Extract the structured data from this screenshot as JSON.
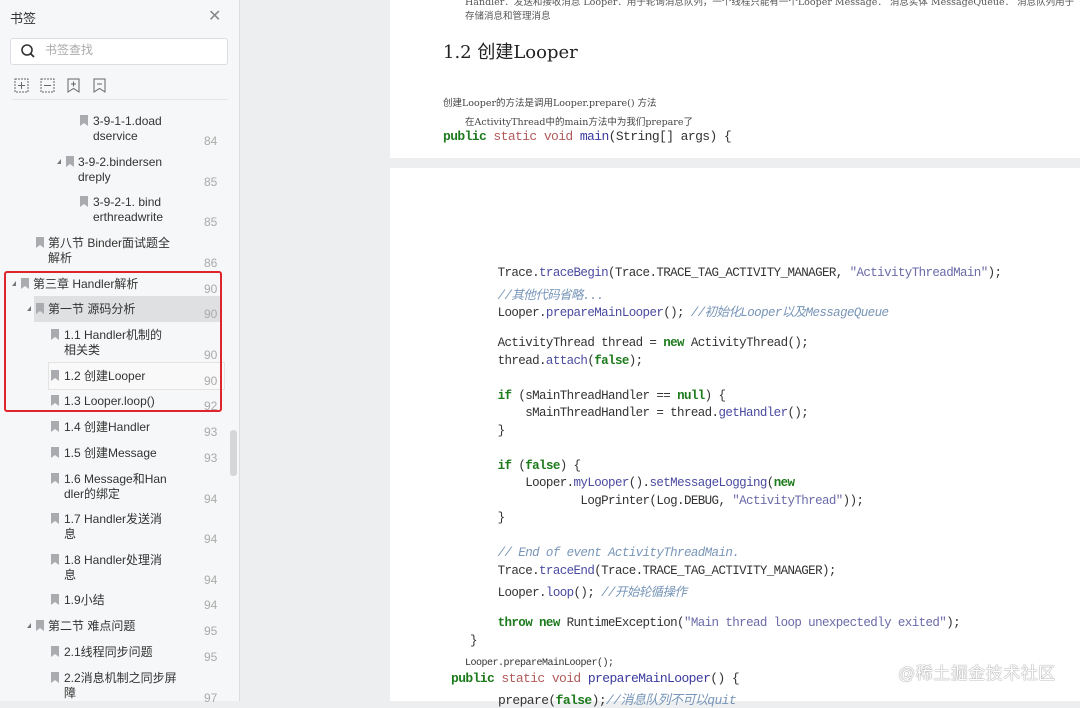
{
  "sidebar": {
    "title": "书签",
    "search_placeholder": "书签查找",
    "tools": [
      "expand-all-icon",
      "collapse-all-icon",
      "add-bookmark-icon",
      "remove-bookmark-icon"
    ],
    "items": [
      {
        "label": "3-9-1-1.doad\ndservice",
        "page": "84"
      },
      {
        "label": "3-9-2.bindersen\ndreply",
        "page": "85"
      },
      {
        "label": "3-9-2-1. bind\nerthreadwrite",
        "page": "85"
      },
      {
        "label": "第八节 Binder面试题全\n解析",
        "page": "86"
      },
      {
        "label": "第三章 Handler解析",
        "page": "90"
      },
      {
        "label": "第一节 源码分析",
        "page": "90"
      },
      {
        "label": "1.1 Handler机制的\n相关类",
        "page": "90"
      },
      {
        "label": "1.2 创建Looper",
        "page": "90"
      },
      {
        "label": "1.3 Looper.loop()",
        "page": "92"
      },
      {
        "label": "1.4 创建Handler",
        "page": "93"
      },
      {
        "label": "1.5 创建Message",
        "page": "93"
      },
      {
        "label": "1.6 Message和Han\ndler的绑定",
        "page": "94"
      },
      {
        "label": "1.7 Handler发送消\n息",
        "page": "94"
      },
      {
        "label": "1.8 Handler处理消\n息",
        "page": "94"
      },
      {
        "label": "1.9小结",
        "page": "94"
      },
      {
        "label": "第二节 难点问题",
        "page": "95"
      },
      {
        "label": "2.1线程同步问题",
        "page": "95"
      },
      {
        "label": "2.2消息机制之同步屏\n障",
        "page": "97"
      }
    ]
  },
  "doc": {
    "top_text": "Handler：发送和接收消息 Looper：用于轮询消息队列，一个线程只能有一个Looper Message： 消息实体 MessageQueue： 消息队列用于存储消息和管理消息",
    "heading": "1.2 创建Looper",
    "para1": "创建Looper的方法是调用Looper.prepare() 方法",
    "para2": "在ActivityThread中的main方法中为我们prepare了",
    "main_sig": [
      [
        "kw",
        "public "
      ],
      [
        "rd",
        "static void "
      ],
      [
        "bl",
        "main"
      ],
      [
        "",
        "(String[] args) {"
      ]
    ],
    "code": [
      [
        [
          "",
          "    Trace."
        ],
        [
          "mt",
          "traceBegin"
        ],
        [
          "",
          "(Trace.TRACE_TAG_ACTIVITY_MANAGER, "
        ],
        [
          "st",
          "\"ActivityThreadMain\""
        ],
        [
          "",
          ");"
        ]
      ],
      [
        [
          "cm",
          "    //其他代码省略..."
        ]
      ],
      [
        [
          "",
          "    Looper."
        ],
        [
          "mt",
          "prepareMainLooper"
        ],
        [
          "",
          "(); "
        ],
        [
          "cm",
          "//初始化Looper以及MessageQueue"
        ]
      ],
      [],
      [
        [
          "",
          "    ActivityThread thread = "
        ],
        [
          "kw",
          "new"
        ],
        [
          "",
          " ActivityThread();"
        ]
      ],
      [
        [
          "",
          "    thread."
        ],
        [
          "mt",
          "attach"
        ],
        [
          "",
          "("
        ],
        [
          "kw",
          "false"
        ],
        [
          "",
          ");"
        ]
      ],
      [],
      [
        [
          "kw",
          "    if"
        ],
        [
          "",
          " (sMainThreadHandler == "
        ],
        [
          "kw",
          "null"
        ],
        [
          "",
          ") {"
        ]
      ],
      [
        [
          "",
          "        sMainThreadHandler = thread."
        ],
        [
          "mt",
          "getHandler"
        ],
        [
          "",
          "();"
        ]
      ],
      [
        [
          "",
          "    }"
        ]
      ],
      [],
      [
        [
          "kw",
          "    if"
        ],
        [
          "",
          " ("
        ],
        [
          "kw",
          "false"
        ],
        [
          "",
          ") {"
        ]
      ],
      [
        [
          "",
          "        Looper."
        ],
        [
          "mt",
          "myLooper"
        ],
        [
          "",
          "()."
        ],
        [
          "mt",
          "setMessageLogging"
        ],
        [
          "",
          "("
        ],
        [
          "kw",
          "new"
        ]
      ],
      [
        [
          "",
          "                LogPrinter(Log.DEBUG, "
        ],
        [
          "st",
          "\"ActivityThread\""
        ],
        [
          "",
          "));"
        ]
      ],
      [
        [
          "",
          "    }"
        ]
      ],
      [],
      [
        [
          "cm",
          "    // End of event ActivityThreadMain."
        ]
      ],
      [
        [
          "",
          "    Trace."
        ],
        [
          "mt",
          "traceEnd"
        ],
        [
          "",
          "(Trace.TRACE_TAG_ACTIVITY_MANAGER);"
        ]
      ],
      [
        [
          "",
          "    Looper."
        ],
        [
          "mt",
          "loop"
        ],
        [
          "",
          "(); "
        ],
        [
          "cm",
          "//开始轮循操作"
        ]
      ],
      [],
      [
        [
          "kw",
          "    throw new"
        ],
        [
          "",
          " RuntimeException("
        ],
        [
          "st",
          "\"Main thread loop unexpectedly exited\""
        ],
        [
          "",
          ");"
        ]
      ],
      [
        [
          "",
          "}"
        ]
      ]
    ],
    "small_call": "Looper.prepareMainLooper();",
    "prep_sig": [
      [
        "kw",
        "public "
      ],
      [
        "rd",
        "static void "
      ],
      [
        "bl",
        "prepareMainLooper"
      ],
      [
        "",
        "() {"
      ]
    ],
    "prep_body": [
      [
        "",
        "prepare("
      ],
      [
        "kw",
        "false"
      ],
      [
        "",
        ");"
      ],
      [
        "cm",
        "//消息队列不可以quit"
      ]
    ],
    "watermark": "@稀土掘金技术社区"
  }
}
